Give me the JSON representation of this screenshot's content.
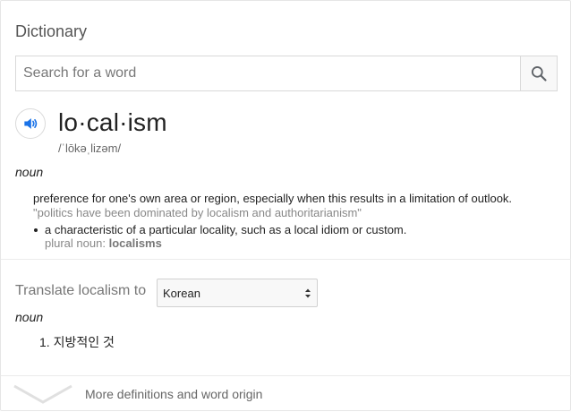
{
  "card": {
    "title": "Dictionary"
  },
  "search": {
    "placeholder": "Search for a word",
    "icon": "search-icon"
  },
  "entry": {
    "headword": "lo·cal·ism",
    "pronunciation": "/ˈlōkəˌlizəm/",
    "part_of_speech": "noun",
    "speaker_icon": "speaker-icon",
    "definitions": [
      {
        "text": "preference for one's own area or region, especially when this results in a limitation of outlook.",
        "example": "\"politics have been dominated by localism and authoritarianism\""
      },
      {
        "text": "a characteristic of a particular locality, such as a local idiom or custom.",
        "plural_label": "plural noun:",
        "plural_value": "localisms"
      }
    ]
  },
  "translate": {
    "label": "Translate localism to",
    "selected_language": "Korean",
    "part_of_speech": "noun",
    "items": [
      {
        "number": "1.",
        "text": "지방적인 것"
      }
    ]
  },
  "footer": {
    "more_label": "More definitions and word origin",
    "icon": "chevron-down-icon"
  },
  "colors": {
    "accent_blue": "#1a73e8",
    "muted_text": "#777777",
    "border": "#d9d9d9"
  }
}
